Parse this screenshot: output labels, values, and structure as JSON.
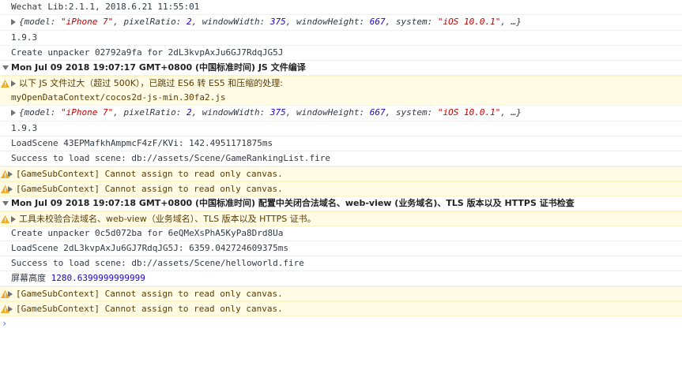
{
  "console": {
    "lines": [
      {
        "type": "log",
        "text": "Wechat Lib:2.1.1, 2018.6.21 11:55:01"
      },
      {
        "type": "object",
        "prefix": "{model: ",
        "model": "\"iPhone 7\"",
        "p2": ", pixelRatio: ",
        "pixelRatio": "2",
        "p3": ", windowWidth: ",
        "windowWidth": "375",
        "p4": ", windowHeight: ",
        "windowHeight": "667",
        "p5": ", system: ",
        "system": "\"iOS 10.0.1\"",
        "suffix": ", …}"
      },
      {
        "type": "log",
        "text": "1.9.3"
      },
      {
        "type": "log",
        "text": "Create unpacker 02792a9fa for 2dL3kvpAxJu6GJ7RdqJG5J"
      },
      {
        "type": "group",
        "text": "Mon Jul 09 2018 19:07:17 GMT+0800 (中国标准时间) JS 文件编译"
      },
      {
        "type": "warn",
        "text": "以下 JS 文件过大（超过 500K），已跳过 ES6 转 ES5 和压缩的处理:",
        "sub": "myOpenDataContext/cocos2d-js-min.30fa2.js"
      },
      {
        "type": "object",
        "prefix": "{model: ",
        "model": "\"iPhone 7\"",
        "p2": ", pixelRatio: ",
        "pixelRatio": "2",
        "p3": ", windowWidth: ",
        "windowWidth": "375",
        "p4": ", windowHeight: ",
        "windowHeight": "667",
        "p5": ", system: ",
        "system": "\"iOS 10.0.1\"",
        "suffix": ", …}"
      },
      {
        "type": "log",
        "text": "1.9.3"
      },
      {
        "type": "log",
        "text": "LoadScene 43EPMafkhAmpmcF4zF/KVi: 142.4951171875ms"
      },
      {
        "type": "log",
        "text": "Success to load scene: db://assets/Scene/GameRankingList.fire"
      },
      {
        "type": "warn-collapsed",
        "text": "[GameSubContext] Cannot assign to read only canvas."
      },
      {
        "type": "warn-collapsed",
        "text": "[GameSubContext] Cannot assign to read only canvas."
      },
      {
        "type": "group",
        "text": "Mon Jul 09 2018 19:07:18 GMT+0800 (中国标准时间) 配置中关闭合法域名、web-view (业务域名)、TLS 版本以及 HTTPS 证书检查"
      },
      {
        "type": "warn",
        "text": "工具未校验合法域名、web-view（业务域名）、TLS 版本以及 HTTPS 证书。"
      },
      {
        "type": "log",
        "text": "Create unpacker 0c5d072ba for 6eQMeXsPhA5KyPa8Drd8Ua"
      },
      {
        "type": "log",
        "text": "LoadScene 2dL3kvpAxJu6GJ7RdqJG5J: 6359.042724609375ms"
      },
      {
        "type": "log",
        "text": "Success to load scene: db://assets/Scene/helloworld.fire"
      },
      {
        "type": "log-num",
        "label": "屏幕高度",
        "value": "1280.6399999999999"
      },
      {
        "type": "warn-collapsed",
        "text": "[GameSubContext] Cannot assign to read only canvas."
      },
      {
        "type": "warn-collapsed",
        "text": "[GameSubContext] Cannot assign to read only canvas."
      }
    ],
    "prompt_symbol": "›"
  },
  "colors": {
    "warn_bg": "#fffbe5",
    "warn_text": "#5c3c00",
    "string": "#c80000",
    "number": "#1c00cf",
    "prompt": "#367cf1"
  },
  "icons": {
    "warning": "warning-triangle-icon",
    "expand": "expand-triangle-icon",
    "prompt": "prompt-chevron-icon"
  }
}
